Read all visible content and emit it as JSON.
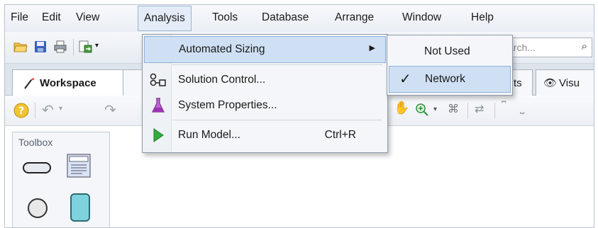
{
  "menubar": {
    "items": [
      {
        "label": "File"
      },
      {
        "label": "Edit"
      },
      {
        "label": "View"
      },
      {
        "label": "Analysis"
      },
      {
        "label": "Tools"
      },
      {
        "label": "Database"
      },
      {
        "label": "Arrange"
      },
      {
        "label": "Window"
      },
      {
        "label": "Help"
      }
    ],
    "active": "Analysis"
  },
  "toolbar": {
    "search_placeholder": "arch...",
    "icons": [
      "open-folder-icon",
      "save-icon",
      "print-icon",
      "export-icon",
      "search-icon"
    ]
  },
  "tabs": {
    "workspace_label": "Workspace",
    "partial_tab_label": "ts",
    "visual_tab_label": "Visu"
  },
  "toolbox": {
    "title": "Toolbox"
  },
  "analysis_menu": {
    "items": [
      {
        "label": "Automated Sizing",
        "shortcut": "",
        "has_submenu": true,
        "icon": ""
      },
      {
        "label": "Solution Control...",
        "shortcut": "",
        "has_submenu": false,
        "icon": "solution-control-icon"
      },
      {
        "label": "System Properties...",
        "shortcut": "",
        "has_submenu": false,
        "icon": "flask-icon"
      },
      {
        "label": "Run Model...",
        "shortcut": "Ctrl+R",
        "has_submenu": false,
        "icon": "run-icon"
      }
    ]
  },
  "sizing_submenu": {
    "items": [
      {
        "label": "Not Used",
        "checked": false
      },
      {
        "label": "Network",
        "checked": true
      }
    ]
  },
  "colors": {
    "menu_highlight": "#cfe0f4",
    "run_icon": "#2fae3a",
    "flask_icon": "#b24bc8"
  }
}
